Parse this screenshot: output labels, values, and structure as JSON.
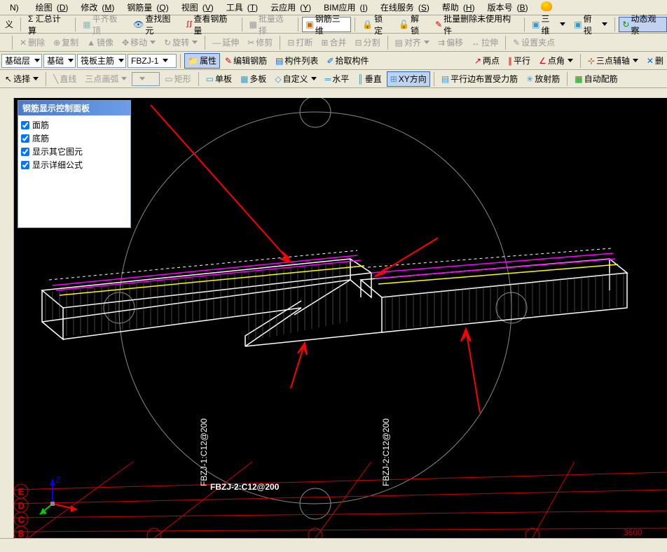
{
  "menu": {
    "items": [
      {
        "label": "N)",
        "u": ""
      },
      {
        "label": "绘图",
        "u": "D"
      },
      {
        "label": "修改",
        "u": "M"
      },
      {
        "label": "钢筋量",
        "u": "Q"
      },
      {
        "label": "视图",
        "u": "V"
      },
      {
        "label": "工具",
        "u": "T"
      },
      {
        "label": "云应用",
        "u": "Y"
      },
      {
        "label": "BIM应用",
        "u": "I"
      },
      {
        "label": "在线服务",
        "u": "S"
      },
      {
        "label": "帮助",
        "u": "H"
      },
      {
        "label": "版本号",
        "u": "B"
      }
    ]
  },
  "tb1": {
    "a": "义",
    "b": "Σ 汇总计算",
    "c": "平齐板顶",
    "d": "查找图元",
    "e": "查看钢筋量",
    "f": "批量选择",
    "g": "钢筋三维",
    "h": "锁定",
    "i": "解锁",
    "j": "批量删除未使用构件",
    "k": "三维",
    "l": "俯视",
    "m": "动态观察"
  },
  "tb2": {
    "a": "删除",
    "b": "复制",
    "c": "镜像",
    "d": "移动",
    "e": "旋转",
    "f": "延伸",
    "g": "修剪",
    "h": "打断",
    "i": "合并",
    "j": "分割",
    "k": "对齐",
    "l": "偏移",
    "m": "拉伸",
    "n": "设置夹点"
  },
  "tb3": {
    "layer": "基础层",
    "cat": "基础",
    "sub": "筏板主筋",
    "id": "FBZJ-1",
    "attr": "属性",
    "edit": "编辑钢筋",
    "list": "构件列表",
    "pick": "拾取构件",
    "r1": "两点",
    "r2": "平行",
    "r3": "点角",
    "r4": "三点辅轴",
    "r5": "删"
  },
  "tb4": {
    "sel": "选择",
    "line": "直线",
    "arc": "三点画弧",
    "rect": "矩形",
    "a": "单板",
    "b": "多板",
    "c": "自定义",
    "d": "水平",
    "e": "垂直",
    "f": "XY方向",
    "g": "平行边布置受力筋",
    "h": "放射筋",
    "i": "自动配筋"
  },
  "panel": {
    "title": "钢筋显示控制面板",
    "items": [
      "面筋",
      "底筋",
      "显示其它图元",
      "显示详细公式"
    ]
  },
  "viewport": {
    "label1": "FBZJ-1:C12@200",
    "label2": "FBZJ-2:C12@200",
    "centerlabel": "FBZJ-2:C12@200",
    "axis_z": "Z",
    "ticks": [
      "E",
      "D",
      "C",
      "B"
    ],
    "num": "3600"
  }
}
